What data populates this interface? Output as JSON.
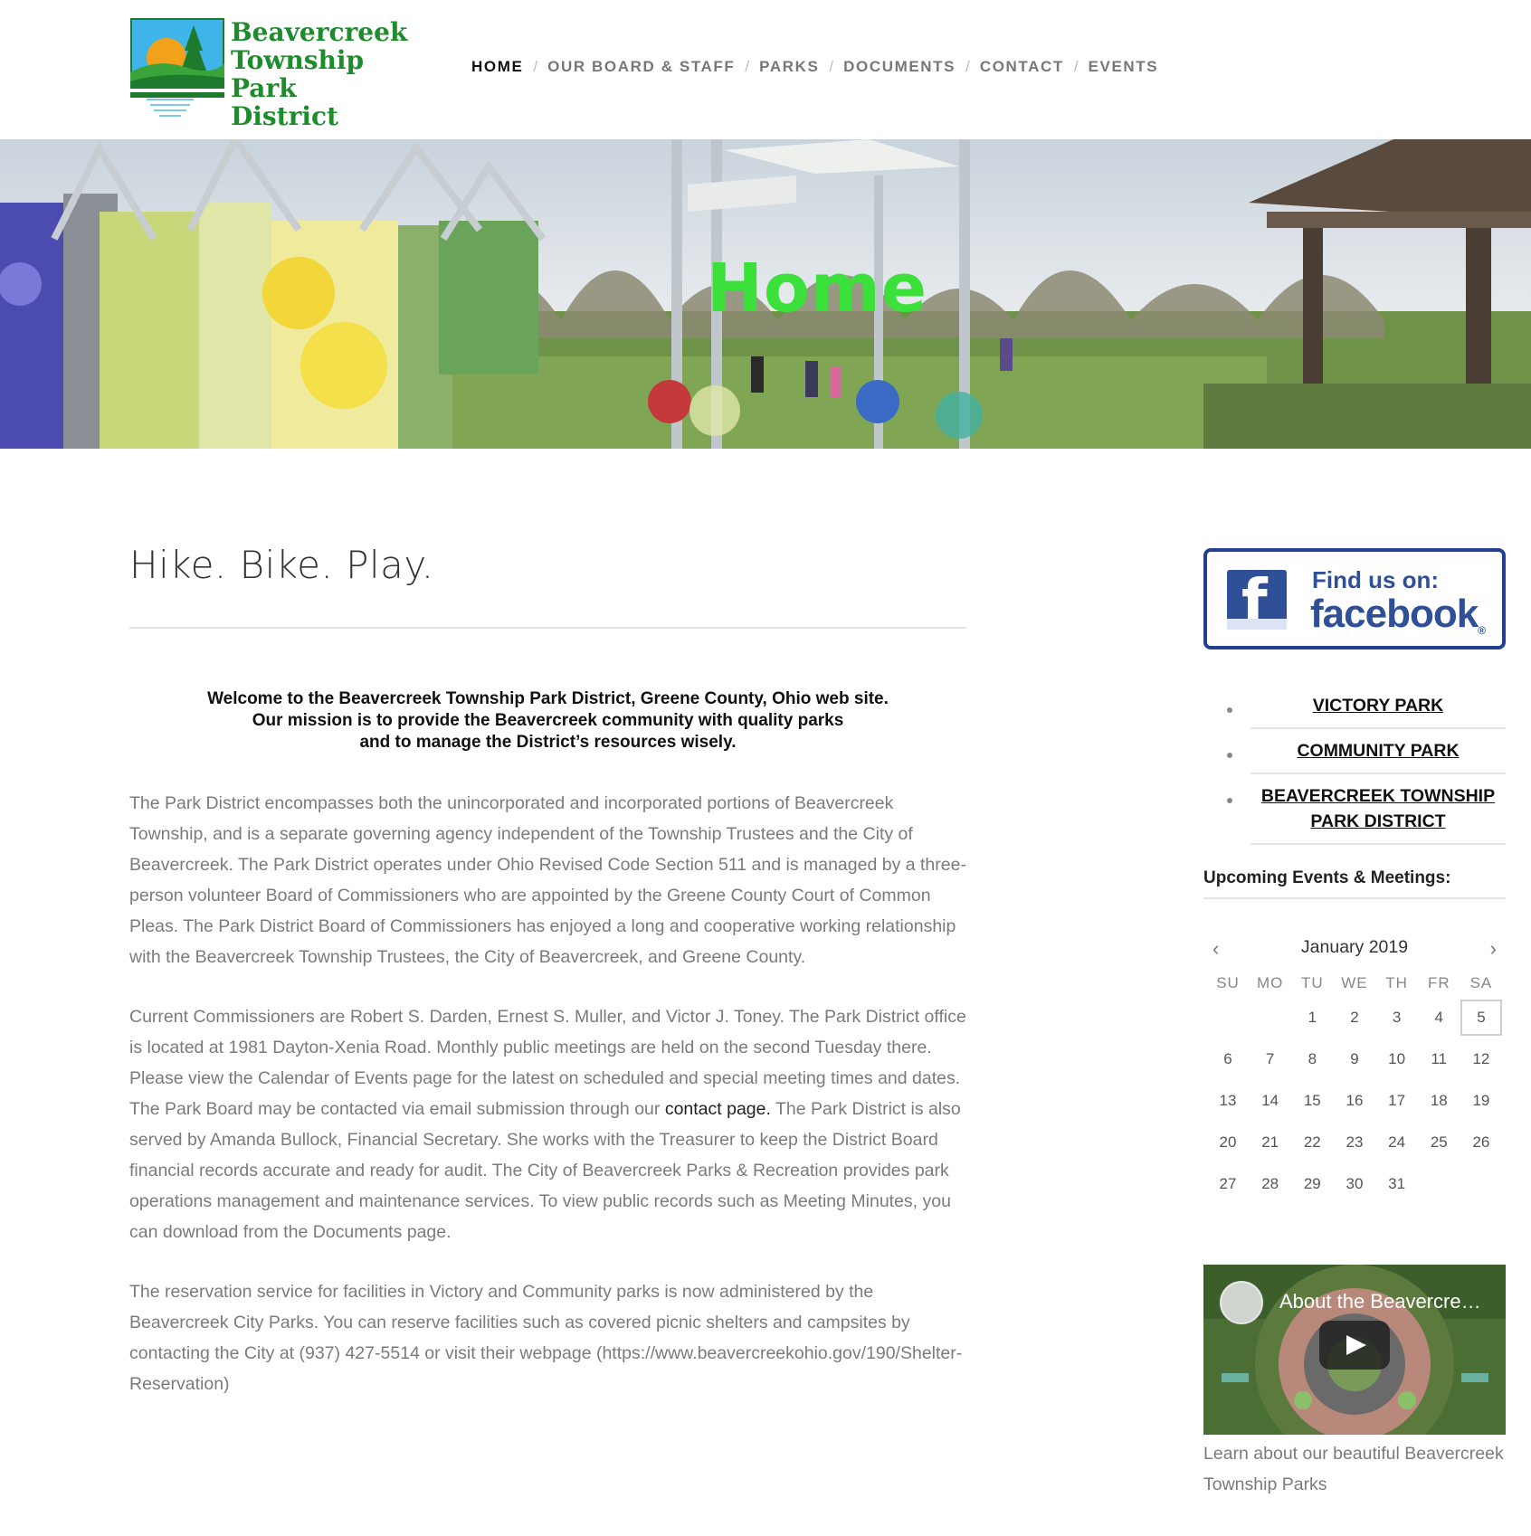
{
  "logo": {
    "line1": "Beavercreek",
    "line2": "Township",
    "line3": "Park District"
  },
  "nav": {
    "items": [
      {
        "label": "HOME",
        "active": true
      },
      {
        "label": "OUR BOARD & STAFF",
        "active": false
      },
      {
        "label": "PARKS",
        "active": false
      },
      {
        "label": "DOCUMENTS",
        "active": false
      },
      {
        "label": "CONTACT",
        "active": false
      },
      {
        "label": "EVENTS",
        "active": false
      }
    ],
    "separator": "/"
  },
  "banner": {
    "title": "Home",
    "title_color": "#3be03a"
  },
  "main": {
    "heading": "Hike. Bike. Play.",
    "welcome": [
      "Welcome to the Beavercreek Township Park District, Greene County, Ohio web site.",
      "Our mission is to provide the Beavercreek community with quality parks",
      "and to manage the District’s resources wisely."
    ],
    "para1": "The Park District encompasses both the unincorporated and incorporated portions of Beavercreek Township, and is a separate governing agency independent of the Township Trustees and the City of Beavercreek. The Park District operates under Ohio Revised Code Section 511 and is managed by a three-person volunteer Board of Commissioners who are appointed by the Greene County Court of Common Pleas. The Park District Board of Commissioners has enjoyed a long and cooperative working relationship with the Beavercreek Township Trustees, the City of Beavercreek, and Greene County.",
    "para2_before": "Current Commissioners are Robert S. Darden, Ernest S. Muller, and Victor J. Toney. The Park District office is located at 1981 Dayton-Xenia Road. Monthly public meetings are held on the second Tuesday there. Please view the Calendar of Events page for the latest on scheduled and special meeting times and dates. The Park Board may be contacted via email submission through our ",
    "para2_link": "contact page.",
    "para2_after": " The Park District is also served by Amanda Bullock, Financial Secretary.  She works with the Treasurer to keep the District Board financial records accurate and ready for audit. The City of Beavercreek Parks & Recreation provides park operations management and maintenance services.  To view public records such as Meeting Minutes, you can download from the Documents page.",
    "para3": "The reservation service for facilities in Victory and Community parks is now administered by the Beavercreek City Parks.  You can reserve facilities such as covered picnic shelters and campsites by contacting the City at (937) 427-5514 or visit their webpage (https://www.beavercreekohio.gov/190/Shelter-Reservation)"
  },
  "sidebar": {
    "facebook": {
      "find": "Find us on:",
      "word": "facebook",
      "color": "#2f4f96"
    },
    "parks": [
      {
        "label": "VICTORY PARK"
      },
      {
        "label": "COMMUNITY PARK"
      },
      {
        "label": "BEAVERCREEK TOWNSHIP PARK DISTRICT"
      }
    ],
    "events_heading": "Upcoming Events & Meetings:",
    "calendar": {
      "month": "January 2019",
      "prev": "‹",
      "next": "›",
      "dow": [
        "SU",
        "MO",
        "TU",
        "WE",
        "TH",
        "FR",
        "SA"
      ],
      "days": [
        "",
        "",
        "1",
        "2",
        "3",
        "4",
        "5",
        "6",
        "7",
        "8",
        "9",
        "10",
        "11",
        "12",
        "13",
        "14",
        "15",
        "16",
        "17",
        "18",
        "19",
        "20",
        "21",
        "22",
        "23",
        "24",
        "25",
        "26",
        "27",
        "28",
        "29",
        "30",
        "31",
        "",
        ""
      ],
      "today": "5"
    },
    "video": {
      "title": "About the Beavercre…",
      "caption": "Learn about our beautiful Beavercreek Township Parks"
    }
  }
}
